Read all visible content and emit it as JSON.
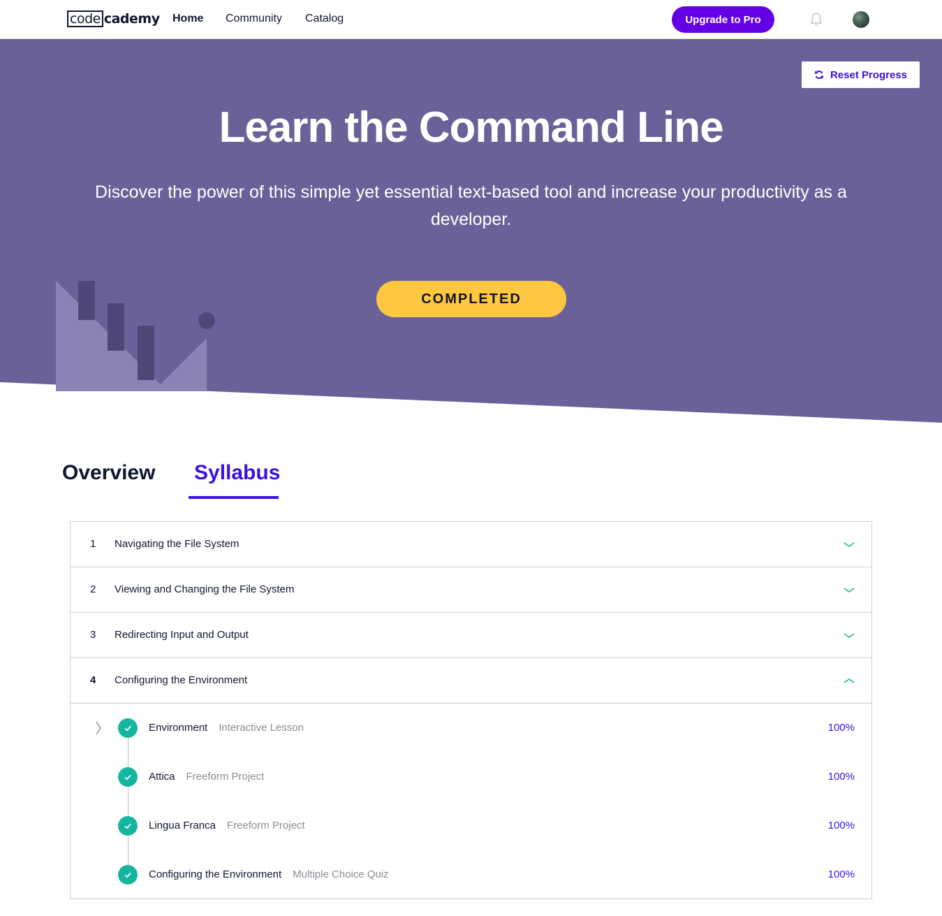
{
  "nav": {
    "logo_box": "code",
    "logo_rest": "cademy",
    "links": [
      "Home",
      "Community",
      "Catalog"
    ],
    "upgrade_label": "Upgrade to Pro",
    "bell_icon": "bell-icon",
    "avatar_icon": "avatar"
  },
  "hero": {
    "reset_label": "Reset Progress",
    "reset_icon": "refresh-icon",
    "title": "Learn the Command Line",
    "description": "Discover the power of this simple yet essential text-based tool and increase your productivity as a developer.",
    "status_label": "COMPLETED",
    "colors": {
      "background": "#6b6199",
      "button": "#ffc740",
      "accent": "#3a10e5"
    }
  },
  "tabs": [
    "Overview",
    "Syllabus"
  ],
  "active_tab": "Syllabus",
  "syllabus": {
    "modules": [
      {
        "num": "1",
        "title": "Navigating the File System",
        "expanded": false
      },
      {
        "num": "2",
        "title": "Viewing and Changing the File System",
        "expanded": false
      },
      {
        "num": "3",
        "title": "Redirecting Input and Output",
        "expanded": false
      },
      {
        "num": "4",
        "title": "Configuring the Environment",
        "expanded": true
      }
    ],
    "lessons": [
      {
        "name": "Environment",
        "type": "Interactive Lesson",
        "progress": "100%",
        "completed": true
      },
      {
        "name": "Attica",
        "type": "Freeform Project",
        "progress": "100%",
        "completed": true
      },
      {
        "name": "Lingua Franca",
        "type": "Freeform Project",
        "progress": "100%",
        "completed": true
      },
      {
        "name": "Configuring the Environment",
        "type": "Multiple Choice Quiz",
        "progress": "100%",
        "completed": true
      }
    ]
  }
}
